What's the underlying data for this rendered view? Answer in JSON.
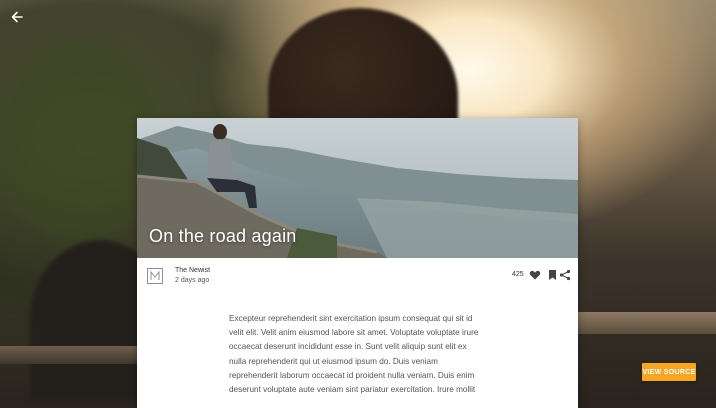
{
  "article": {
    "title": "On the road again",
    "publisher": "The Newist",
    "posted": "2 days ago",
    "likes": "425",
    "body": "Excepteur reprehenderit sint exercitation ipsum consequat qui sit id velit elit. Velit anim eiusmod labore sit amet. Voluptate voluptate irure occaecat deserunt incididunt esse in. Sunt velit aliquip sunt elit ex nulla reprehenderit qui ut eiusmod ipsum do. Duis veniam reprehenderit laborum occaecat id proident nulla veniam. Duis enim deserunt voluptate aute veniam sint pariatur exercitation. Irure mollit"
  },
  "actions": {
    "view_source_label": "VIEW SOURCE"
  },
  "icons": {
    "back": "arrow-left-icon",
    "publisher_logo": "publisher-logo-icon",
    "like": "heart-icon",
    "bookmark": "bookmark-icon",
    "share": "share-icon"
  },
  "colors": {
    "accent": "#f5a623",
    "card_bg": "#ffffff",
    "body_text": "#555555"
  }
}
